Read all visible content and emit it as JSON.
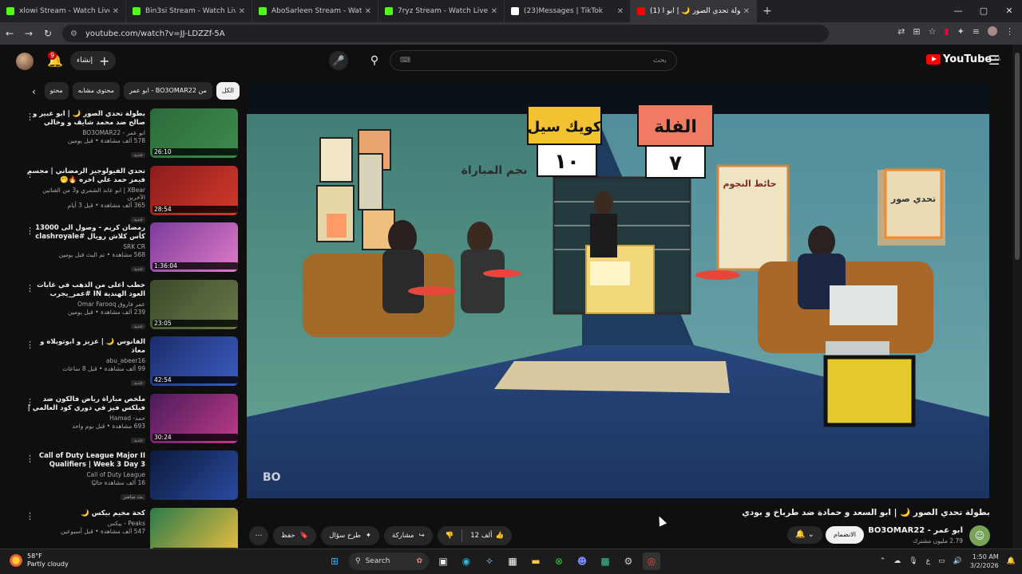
{
  "browser": {
    "tabs": [
      {
        "title": "xlowi Stream - Watch Live on Kick",
        "color": "#53fc18"
      },
      {
        "title": "Bin3si Stream - Watch Live on Kick",
        "color": "#53fc18"
      },
      {
        "title": "AboSarleen Stream - Watch Live on Kick",
        "color": "#53fc18"
      },
      {
        "title": "7ryz Stream - Watch Live on Kick",
        "color": "#53fc18"
      },
      {
        "title": "(23)Messages | TikTok",
        "color": "#ffffff"
      },
      {
        "title": "(1) بطولة تحدي الصور 🌙 | ابو ا",
        "color": "#ff0000"
      }
    ],
    "url": "youtube.com/watch?v=JJ-LDZZf-5A"
  },
  "youtube": {
    "create_label": "إنشاء",
    "notif_count": "9",
    "search_placeholder": "بحث",
    "logo_text": "YouTube",
    "logo_region": "SA"
  },
  "chips": [
    "الكل",
    "من BO3OMAR22 - ابو عمر",
    "محتوى مشابه",
    "محتو"
  ],
  "related": [
    {
      "title": "بطولة تحدي الصور 🌙 | ابو عبير و صالح ضد محمد شايف و وخالي",
      "channel": "ابو عمر - BO3OMAR22",
      "views": "578 ألف مشاهدة • قبل يومين",
      "badge": "جديد",
      "duration": "26:10"
    },
    {
      "title": "تحدي الفيولوجيز الرمضاني | مجسم فيمز حمد علي اخره 🔥🤭",
      "channel": "XBear | ابو عابد الشمري و3 من الفنانين الآخرين",
      "views": "365 ألف مشاهدة • قبل 3 أيام",
      "badge": "جديد",
      "duration": "28:54"
    },
    {
      "title": "رمضان كريم - وصول الى 13000 كأس كلاش رويال #clashroyale shorts",
      "channel": "SRK CR",
      "views": "568 مشاهدة • تم البث قبل يومين",
      "badge": "جديد",
      "duration": "1:36:04"
    },
    {
      "title": "خطب أعلى من الذهب في غابات العود الهندية IN #عمر_يجرب",
      "channel": "عمر فاروق Omar Farooq",
      "views": "239 ألف مشاهدة • قبل يومين",
      "badge": "جديد",
      "duration": "23:05"
    },
    {
      "title": "الفانوس 🌙 | عزيز و ابوثوبلاه و معاذ",
      "channel": "abu_abeer16",
      "views": "99 ألف مشاهدة • قبل 8 ساعات",
      "badge": "جديد",
      "duration": "42:54"
    },
    {
      "title": "ملخص مباراة رياض فالكون ضد فيلكس فيز في دوري كود العالمي | Riyadh Falcons...",
      "channel": "حمد- Hamad",
      "views": "693 مشاهدة • قبل يوم واحد",
      "badge": "جديد",
      "duration": "30:24"
    },
    {
      "title": "Call of Duty League Major II Qualifiers | Week 3 Day 3",
      "channel": "Call of Duty League",
      "views": "16 ألف مشاهدة حاليًا",
      "badge": "بث مباشر",
      "duration": ""
    },
    {
      "title": "كحة مخيم بيكس 🌙",
      "channel": "Peaks - بيكس",
      "views": "547 ألف مشاهدة • قبل أسبوعين",
      "badge": "",
      "duration": "40:35"
    }
  ],
  "player": {
    "scores": [
      {
        "team": "كويك سيل",
        "score": "١٠"
      },
      {
        "team": "الفلة",
        "score": "٧"
      }
    ],
    "wall_text": "نجم المباراة",
    "stars_text": "حائط النجوم",
    "sign_text": "تحدي صور",
    "watermark": "BO"
  },
  "video": {
    "title": "بطولة تحدي الصور 🌙 | ابو السعد و حمادة ضد طرباخ و بودي",
    "channel": "ابو عمر - BO3OMAR22",
    "subscribers": "2.79 مليون مشترك",
    "join_label": "الانضمام",
    "likes": "12 ألف",
    "share_label": "مشاركة",
    "ask_label": "طرح سؤال",
    "save_label": "حفظ"
  },
  "taskbar": {
    "temp": "58°F",
    "weather": "Partly cloudy",
    "search": "Search",
    "time": "1:50 AM",
    "date": "3/2/2026",
    "lang": "ع"
  }
}
